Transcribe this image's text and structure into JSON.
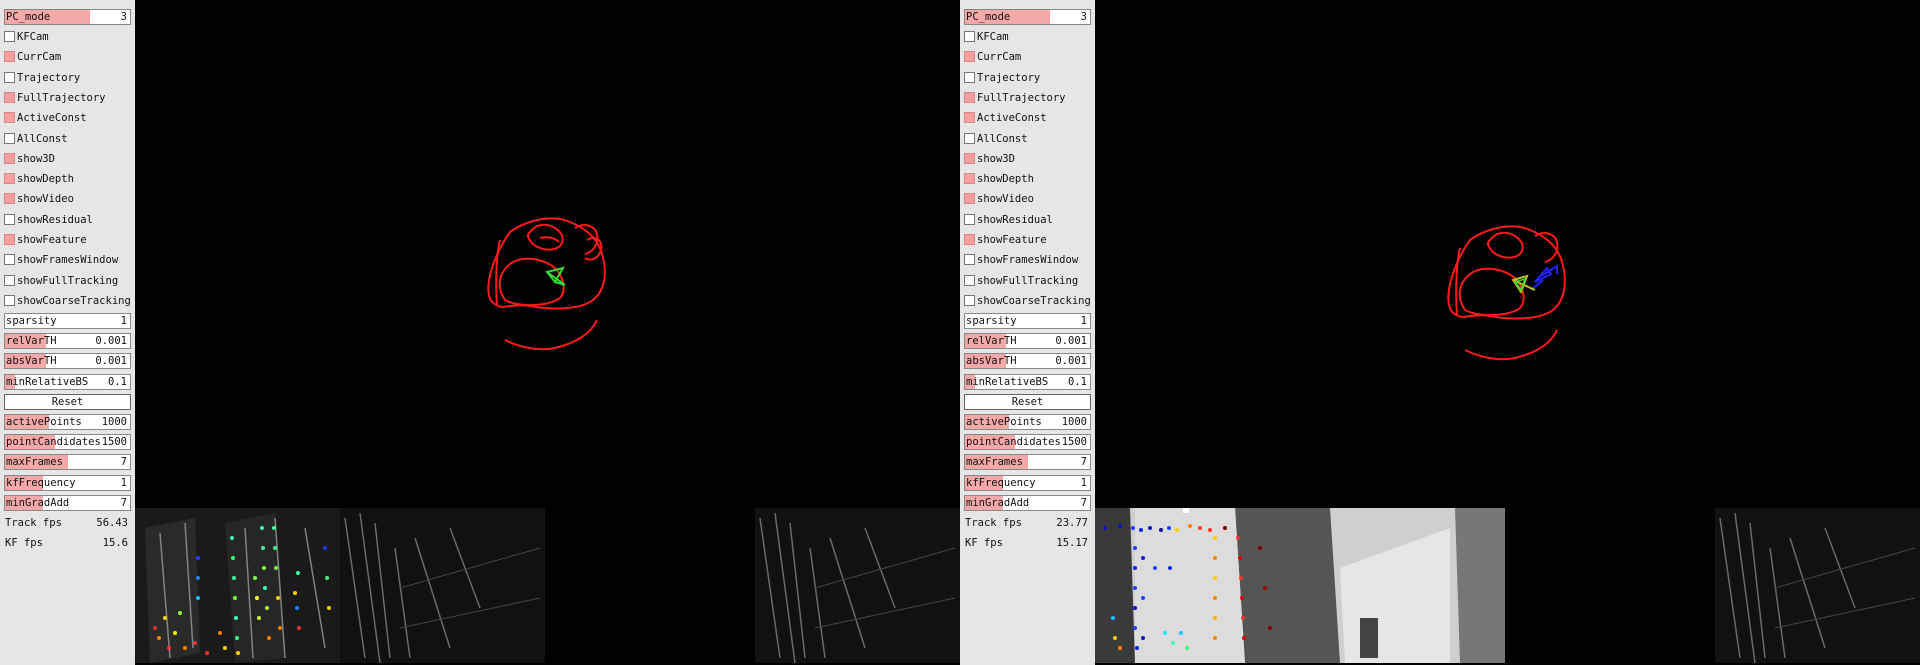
{
  "panel_shared": {
    "pc_mode_label": "PC_mode",
    "pc_mode_value": "3",
    "checkboxes": [
      {
        "label": "KFCam",
        "checked": false
      },
      {
        "label": "CurrCam",
        "checked": true
      },
      {
        "label": "Trajectory",
        "checked": false
      },
      {
        "label": "FullTrajectory",
        "checked": true
      },
      {
        "label": "ActiveConst",
        "checked": true
      },
      {
        "label": "AllConst",
        "checked": false
      },
      {
        "label": "show3D",
        "checked": true
      },
      {
        "label": "showDepth",
        "checked": true
      },
      {
        "label": "showVideo",
        "checked": true
      },
      {
        "label": "showResidual",
        "checked": false
      },
      {
        "label": "showFeature",
        "checked": true
      },
      {
        "label": "showFramesWindow",
        "checked": false
      },
      {
        "label": "showFullTracking",
        "checked": false
      },
      {
        "label": "showCoarseTracking",
        "checked": false
      }
    ],
    "params_top": [
      {
        "label": "sparsity",
        "value": "1",
        "fill": 0
      },
      {
        "label": "relVarTH",
        "value": "0.001",
        "fill": 0.33
      },
      {
        "label": "absVarTH",
        "value": "0.001",
        "fill": 0.33
      },
      {
        "label": "minRelativeBS",
        "value": "0.1",
        "fill": 0.08
      }
    ],
    "reset_label": "Reset",
    "params_bottom": [
      {
        "label": "activePoints",
        "value": "1000",
        "fill": 0.35
      },
      {
        "label": "pointCandidates",
        "value": "1500",
        "fill": 0.4
      },
      {
        "label": "maxFrames",
        "value": "7",
        "fill": 0.5
      },
      {
        "label": "kfFrequency",
        "value": "1",
        "fill": 0.3
      },
      {
        "label": "minGradAdd",
        "value": "7",
        "fill": 0.3
      }
    ],
    "track_fps_label": "Track fps",
    "kf_fps_label": "KF fps"
  },
  "left_view": {
    "track_fps": "56.43",
    "kf_fps": "15.6"
  },
  "right_view": {
    "track_fps": "23.77",
    "kf_fps": "15.17"
  },
  "colors": {
    "trajectory": "#ff1a1a",
    "camera": "#33dd33",
    "keyframe": "#2222ff",
    "checked_fill": "#f5a0a0"
  }
}
